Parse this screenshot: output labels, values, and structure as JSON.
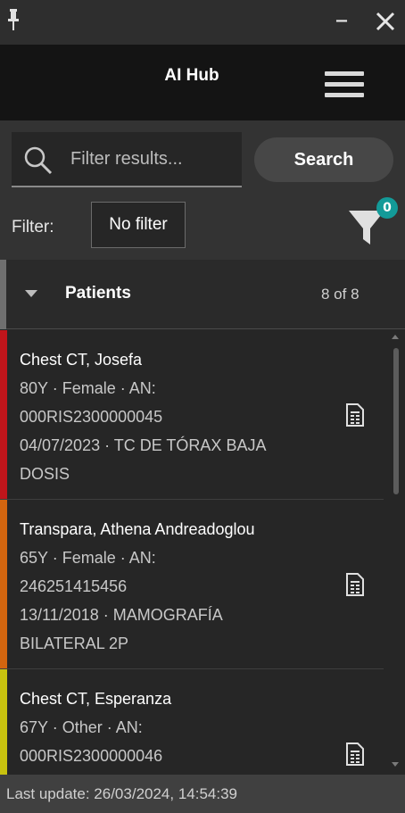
{
  "window": {
    "pin_icon": "pin-icon",
    "minimize_icon": "minimize-icon",
    "close_icon": "close-icon"
  },
  "header": {
    "title": "AI Hub",
    "menu_icon": "hamburger-menu-icon"
  },
  "search": {
    "placeholder": "Filter results...",
    "button_label": "Search"
  },
  "filter": {
    "label": "Filter:",
    "value": "No filter",
    "funnel_badge": "0",
    "badge_color": "#139a98"
  },
  "group": {
    "title": "Patients",
    "count": "8 of 8"
  },
  "patients": [
    {
      "name": "Chest CT, Josefa",
      "line1": "80Y · Female · AN:",
      "line2": "000RIS2300000045",
      "line3": "04/07/2023 · TC DE TÓRAX BAJA",
      "line4": "DOSIS",
      "color": "#c0151b"
    },
    {
      "name": "Transpara, Athena Andreadoglou",
      "line1": "65Y · Female · AN:",
      "line2": "246251415456",
      "line3": "13/11/2018 · MAMOGRAFÍA",
      "line4": "BILATERAL 2P",
      "color": "#d2650f"
    },
    {
      "name": "Chest CT, Esperanza",
      "line1": "67Y · Other · AN:",
      "line2": "000RIS2300000046",
      "line3": "",
      "line4": "",
      "color": "#c8c20f"
    }
  ],
  "footer": {
    "last_update": "Last update: 26/03/2024, 14:54:39"
  }
}
